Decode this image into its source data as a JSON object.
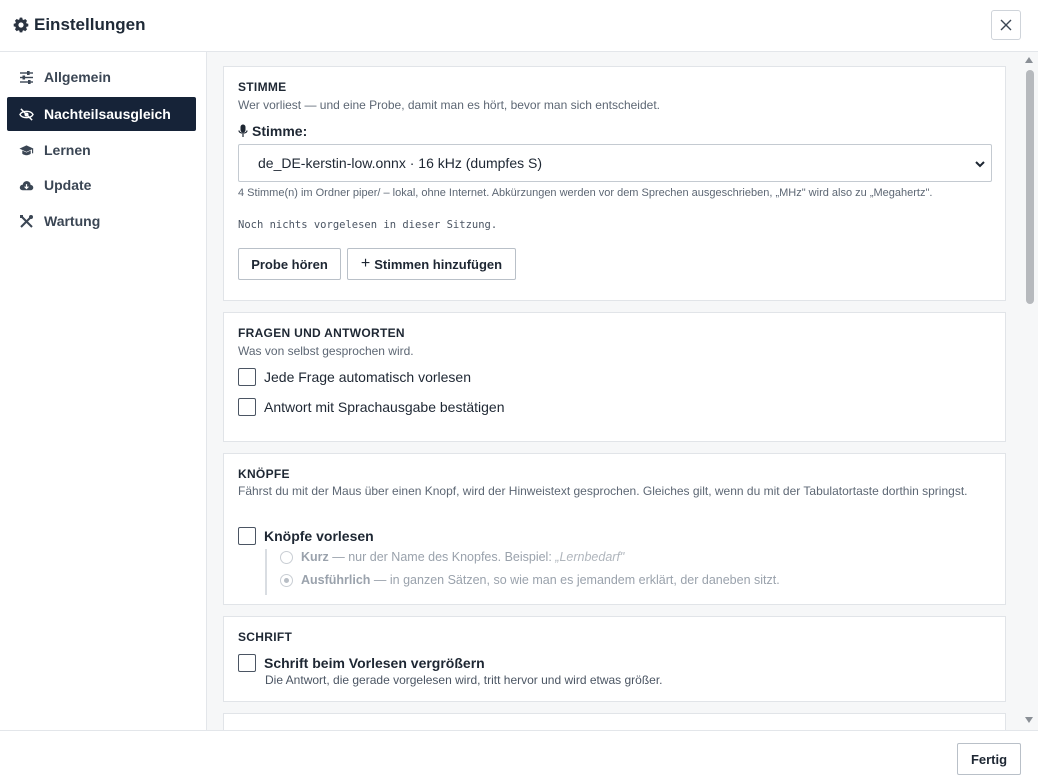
{
  "header": {
    "title": "Einstellungen",
    "icon": "gear-icon",
    "close_icon": "close-icon"
  },
  "sidebar": {
    "items": [
      {
        "label": "Allgemein",
        "icon": "sliders-icon",
        "active": false
      },
      {
        "label": "Nachteilsausgleich",
        "icon": "eye-slash-icon",
        "active": true
      },
      {
        "label": "Lernen",
        "icon": "graduation-cap-icon",
        "active": false
      },
      {
        "label": "Update",
        "icon": "cloud-download-icon",
        "active": false
      },
      {
        "label": "Wartung",
        "icon": "tools-icon",
        "active": false
      }
    ],
    "active_bg": "#162338"
  },
  "voice": {
    "heading": "STIMME",
    "description": "Wer vorliest — und eine Probe, damit man es hört, bevor man sich entscheidet.",
    "label": "Stimme:",
    "select_value": "de_DE-kerstin-low.onnx · 16 kHz (dumpfes S)",
    "hint": "4 Stimme(n) im Ordner piper/ – lokal, ohne Internet. Abkürzungen werden vor dem Sprechen ausgeschrieben, „MHz\" wird also zu „Megahertz\".",
    "status": "Noch nichts vorgelesen in dieser Sitzung.",
    "btn_sample": "Probe hören",
    "btn_add": "Stimmen hinzufügen"
  },
  "qa": {
    "heading": "FRAGEN UND ANTWORTEN",
    "description": "Was von selbst gesprochen wird.",
    "option1": "Jede Frage automatisch vorlesen",
    "option2": "Antwort mit Sprachausgabe bestätigen"
  },
  "buttons": {
    "heading": "KNÖPFE",
    "description": "Fährst du mit der Maus über einen Knopf, wird der Hinweistext gesprochen. Gleiches gilt, wenn du mit der Tabulatortaste dorthin springst.",
    "option": "Knöpfe vorlesen",
    "short_title": "Kurz",
    "short_desc": " — nur der Name des Knopfes. Beispiel: ",
    "short_example": "„Lernbedarf\"",
    "long_title": "Ausführlich",
    "long_desc": " — in ganzen Sätzen, so wie man es jemandem erklärt, der daneben sitzt."
  },
  "font": {
    "heading": "SCHRIFT",
    "option": "Schrift beim Vorlesen vergrößern",
    "option_desc": "Die Antwort, die gerade vorgelesen wird, tritt hervor und wird etwas größer."
  },
  "footer": {
    "done": "Fertig"
  }
}
